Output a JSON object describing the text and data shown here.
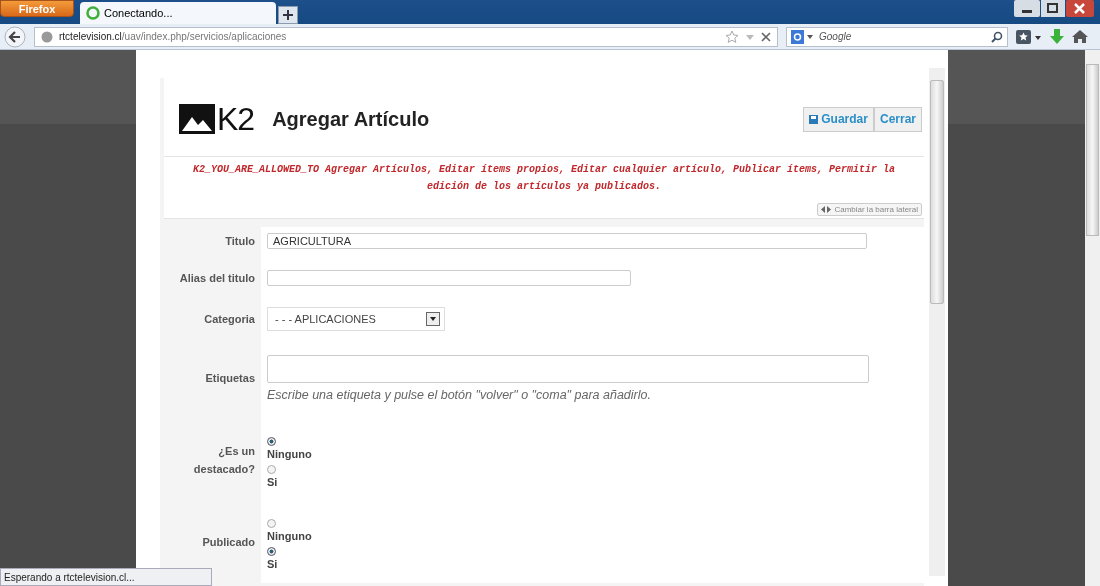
{
  "browser": {
    "app_button": "Firefox",
    "tabs": [
      {
        "label": "Conectando...",
        "selected": true
      }
    ],
    "url": {
      "host": "rtctelevision.cl",
      "path": "/uav/index.php/servicios/aplicaciones"
    },
    "search": {
      "placeholder": "Google"
    }
  },
  "page": {
    "logo": "K2",
    "title": "Agregar Artículo",
    "buttons": [
      {
        "label": "Guardar",
        "kind": "save"
      },
      {
        "label": "Cerrar",
        "kind": "close"
      }
    ],
    "notice": "K2_YOU_ARE_ALLOWED_TO Agregar Artículos, Editar ítems propios, Editar cualquier artículo, Publicar ítems, Permitir la edición de los artículos ya publicados.",
    "sidebar_toggle": "Cambiar la barra lateral",
    "fields": [
      {
        "kind": "text",
        "label": "Titulo",
        "value": "AGRICULTURA"
      },
      {
        "kind": "short",
        "label": "Alias del titulo"
      },
      {
        "kind": "select",
        "label": "Categoria",
        "value": "- - - APLICACIONES"
      },
      {
        "kind": "tags",
        "label": "Etiquetas",
        "hint": "Escribe una etiqueta y pulse el botón \"volver\" o \"coma\" para añadirlo."
      },
      {
        "kind": "radio",
        "label": "¿Es un destacado?",
        "options": [
          {
            "label": "Ninguno",
            "selected": true
          },
          {
            "label": "Si",
            "selected": false
          }
        ]
      },
      {
        "kind": "radio",
        "label": "Publicado",
        "options": [
          {
            "label": "Ninguno",
            "selected": false
          },
          {
            "label": "Si",
            "selected": true
          }
        ]
      }
    ]
  },
  "status_bar": "Esperando a rtctelevision.cl..."
}
